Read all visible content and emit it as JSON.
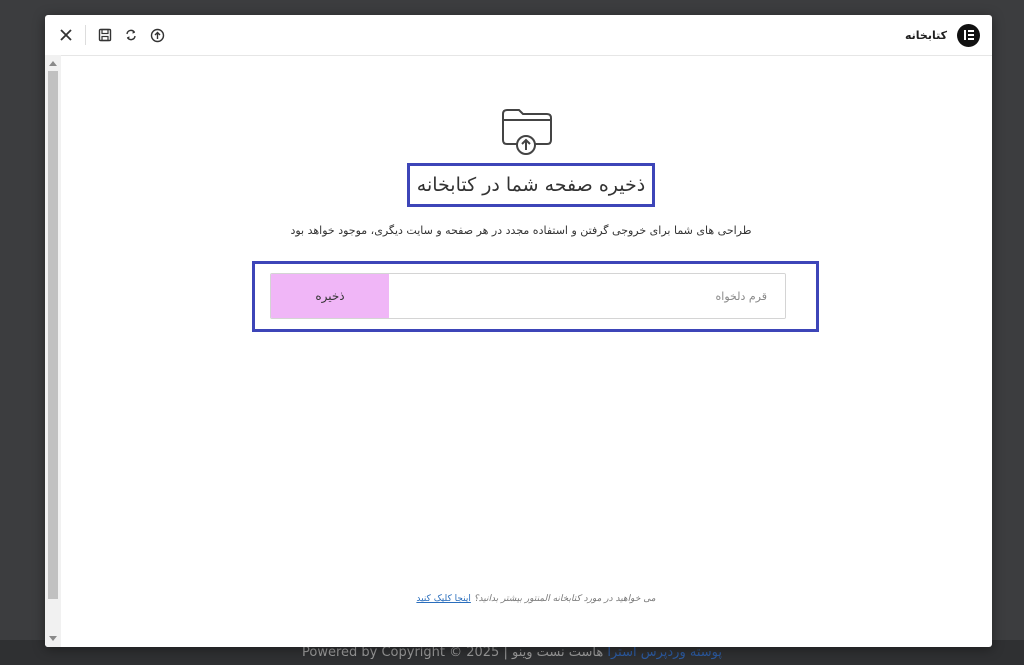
{
  "background": {
    "footer_text": "هاست نست وینو | Powered by Copyright © 2025",
    "footer_brand": "پوسته وردپرس استرا"
  },
  "header": {
    "title": "کتابخانه",
    "icons": {
      "close": "close-icon",
      "save": "floppy-disk-icon",
      "sync": "sync-icon",
      "upload": "upload-icon",
      "logo": "elementor-logo-icon"
    }
  },
  "main": {
    "title": "ذخیره صفحه شما در کتابخانه",
    "subtitle": "طراحی های شما برای خروجی گرفتن و استفاده مجدد در هر صفحه و سایت دیگری، موجود خواهد بود",
    "form": {
      "input_placeholder": "قرم دلخواه",
      "input_value": "",
      "save_label": "ذخیره"
    },
    "footer_note": {
      "text": "می خواهید در مورد کتابخانه المنتور بیشتر بدانید؟",
      "link": "اینجا کلیک کنید"
    }
  },
  "colors": {
    "highlight_border": "#3d45b8",
    "save_button": "#f0b6f7",
    "link": "#2a6ebd"
  }
}
